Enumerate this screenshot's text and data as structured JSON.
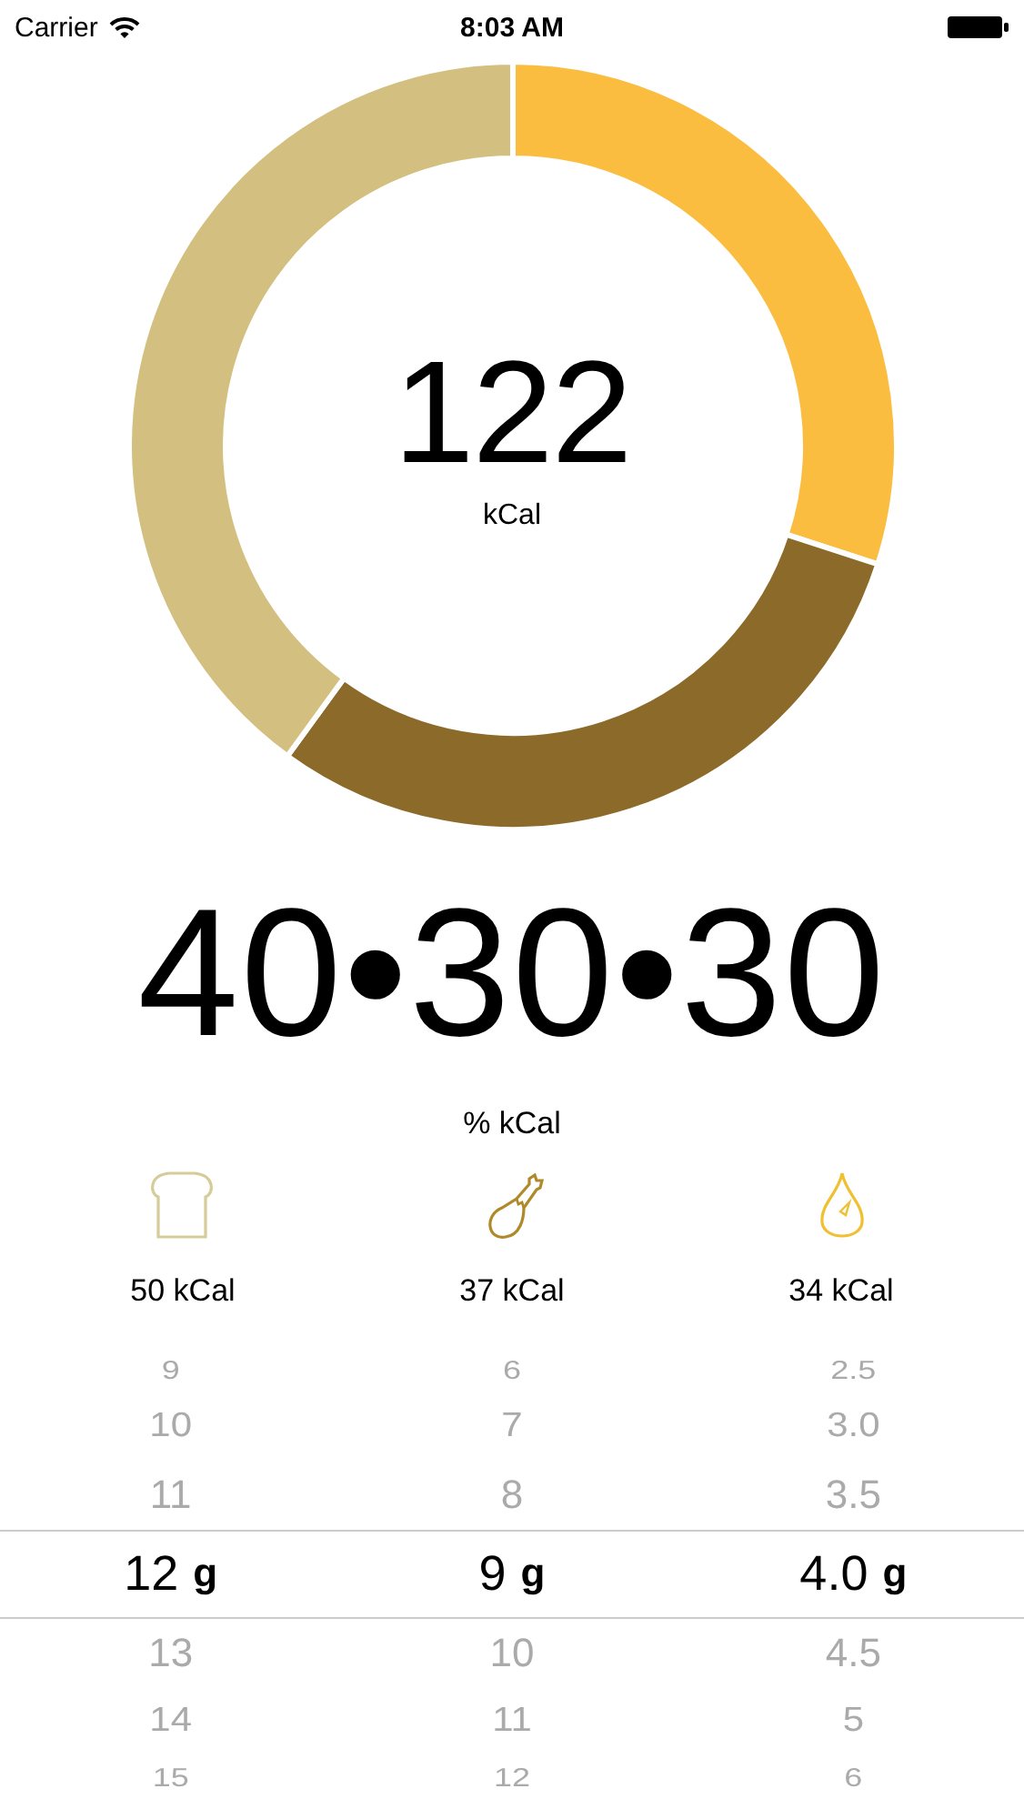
{
  "status_bar": {
    "carrier": "Carrier",
    "time": "8:03 AM"
  },
  "summary": {
    "chart_data": {
      "type": "donut",
      "values": [
        30,
        30,
        40
      ],
      "colors": [
        "#fbbd40",
        "#8c6b2a",
        "#d3c080"
      ]
    },
    "total": "122",
    "unit": "kCal"
  },
  "ratio": {
    "value": "40•30•30",
    "label": "% kCal"
  },
  "macros": [
    {
      "kind": "carbs",
      "color": "#d6cc9a",
      "kcal": "50 kCal"
    },
    {
      "kind": "protein",
      "color": "#b08a2a",
      "kcal": "37 kCal"
    },
    {
      "kind": "fat",
      "color": "#f0c030",
      "kcal": "34 kCal"
    }
  ],
  "pickers": [
    {
      "unit": "g",
      "rows": [
        {
          "text": "9",
          "selected": false
        },
        {
          "text": "10",
          "selected": false
        },
        {
          "text": "11",
          "selected": false
        },
        {
          "text": "12",
          "selected": true
        },
        {
          "text": "13",
          "selected": false
        },
        {
          "text": "14",
          "selected": false
        },
        {
          "text": "15",
          "selected": false
        }
      ]
    },
    {
      "unit": "g",
      "rows": [
        {
          "text": "6",
          "selected": false
        },
        {
          "text": "7",
          "selected": false
        },
        {
          "text": "8",
          "selected": false
        },
        {
          "text": "9",
          "selected": true
        },
        {
          "text": "10",
          "selected": false
        },
        {
          "text": "11",
          "selected": false
        },
        {
          "text": "12",
          "selected": false
        }
      ]
    },
    {
      "unit": "g",
      "rows": [
        {
          "text": "2.5",
          "selected": false
        },
        {
          "text": "3.0",
          "selected": false
        },
        {
          "text": "3.5",
          "selected": false
        },
        {
          "text": "4.0",
          "selected": true
        },
        {
          "text": "4.5",
          "selected": false
        },
        {
          "text": "5",
          "selected": false
        },
        {
          "text": "6",
          "selected": false
        }
      ]
    }
  ]
}
